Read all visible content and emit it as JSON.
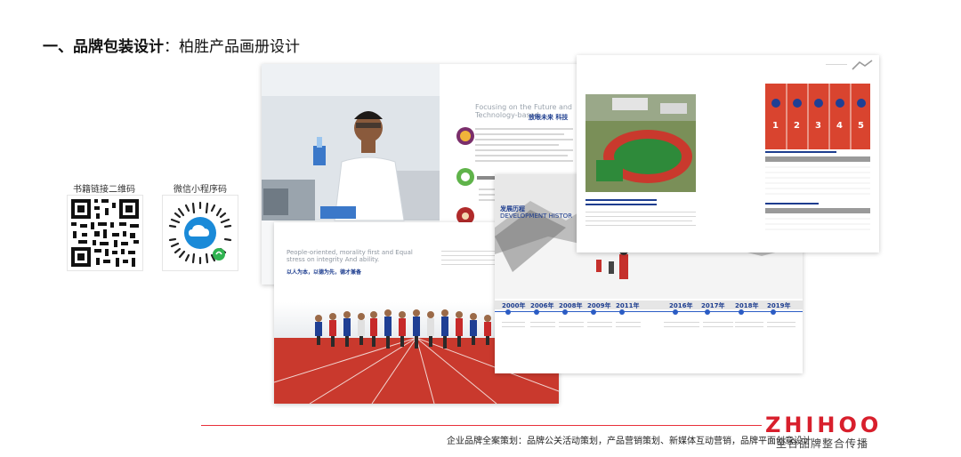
{
  "header": {
    "title_bold": "一、品牌包装设计",
    "title_sep": "：",
    "title_rest": "柏胜产品画册设计"
  },
  "qr": {
    "book_label": "书籍链接二维码",
    "wechat_label": "微信小程序码"
  },
  "brochure": {
    "page1": {
      "heading_en": "Focusing on the Future and Technology-based",
      "heading_cn": "放眼未来 科技"
    },
    "page2": {
      "heading_en": "People-oriented, morality first and Equal stress on integrity And ability.",
      "heading_cn": "以人为本，以德为先，德才兼备"
    },
    "page3": {
      "heading_cn": "发展历程",
      "heading_en": "DEVELOPMENT HISTOR",
      "years": [
        "2000年",
        "2006年",
        "2008年",
        "2009年",
        "2011年",
        "2016年",
        "2017年",
        "2018年",
        "2019年"
      ]
    }
  },
  "footer": {
    "services": "企业品牌全案策划：品牌公关活动策划，产品营销策划、新媒体互动营销，品牌平面创意设计",
    "brand_name": "ZHIHOO",
    "brand_tagline": "至合品牌整合传播"
  },
  "colors": {
    "accent_red": "#d81f2c",
    "navy": "#1d3d8f",
    "track_red": "#c9392d"
  }
}
